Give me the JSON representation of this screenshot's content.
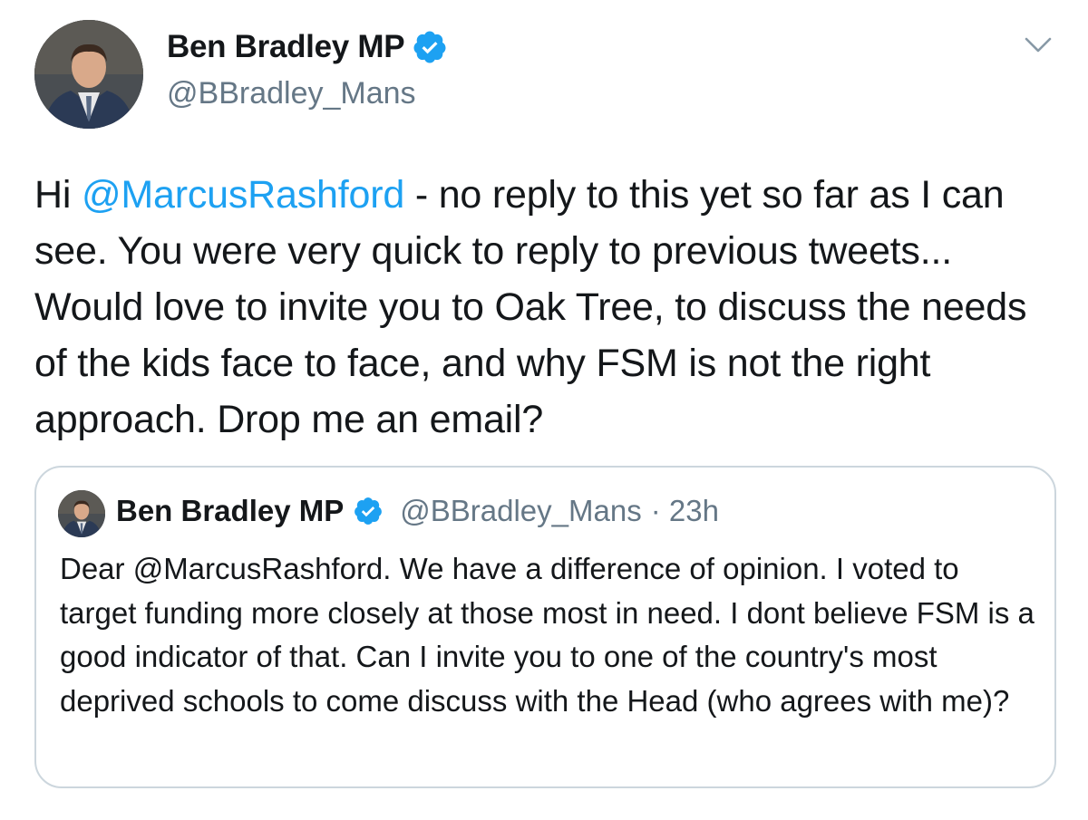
{
  "tweet": {
    "author": {
      "name": "Ben Bradley MP",
      "handle": "@BBradley_Mans",
      "verified": true
    },
    "text": {
      "prefix": "Hi ",
      "mention": "@MarcusRashford",
      "body": " - no reply to this yet so far as I can see. You were very quick to reply to previous tweets... Would love to invite you to Oak Tree, to discuss the needs of the kids face to face, and why FSM is not the right approach. Drop me an email?"
    },
    "menu_icon": "chevron-down-icon"
  },
  "quoted_tweet": {
    "author": {
      "name": "Ben Bradley MP",
      "handle": "@BBradley_Mans",
      "verified": true
    },
    "meta": "· 23h",
    "text": "Dear @MarcusRashford. We have a difference of opinion. I voted to target funding more closely at those most in need. I dont believe FSM is a good indicator of that. Can I invite you to one of the country's most deprived schools to come discuss with the Head (who agrees with me)?"
  },
  "colors": {
    "link": "#1da1f2",
    "verified": "#1da1f2",
    "secondary_text": "#657786",
    "border": "#ccd6dd"
  }
}
